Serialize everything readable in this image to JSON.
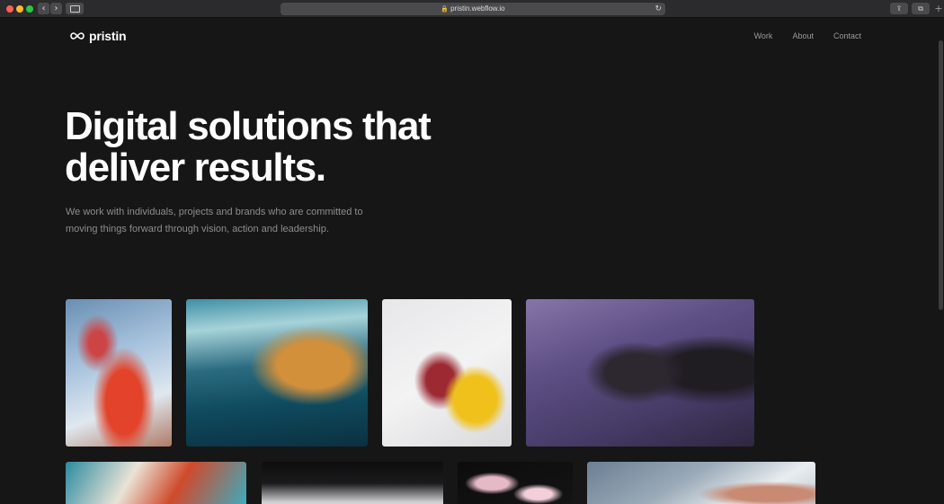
{
  "browser": {
    "url": "pristin.webflow.io"
  },
  "site": {
    "logo_text": "pristin",
    "nav": [
      {
        "label": "Work"
      },
      {
        "label": "About"
      },
      {
        "label": "Contact"
      }
    ]
  },
  "hero": {
    "title_line1": "Digital solutions that",
    "title_line2": "deliver results.",
    "subtitle_line1": "We work with individuals, projects and brands who are committed to",
    "subtitle_line2": "moving things forward through vision, action and leadership."
  },
  "gallery": [
    {
      "icon": "portrait-photo"
    },
    {
      "icon": "abstract-wave-art"
    },
    {
      "icon": "sneaker-photo"
    },
    {
      "icon": "purple-field-portrait"
    },
    {
      "icon": "abstract-fluid-art"
    },
    {
      "icon": "laptop-photo"
    },
    {
      "icon": "flowers-photo"
    },
    {
      "icon": "desk-work-photo"
    }
  ],
  "colors": {
    "background": "#161617",
    "text_primary": "#ffffff",
    "text_muted": "#8d8d90"
  }
}
